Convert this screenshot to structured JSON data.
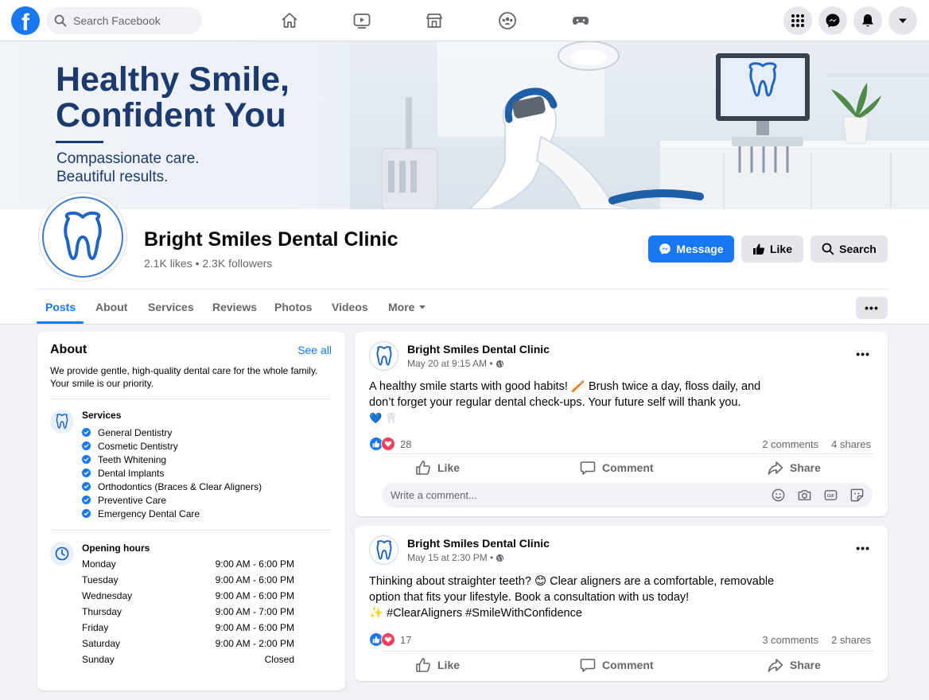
{
  "topnav": {
    "logo_letter": "f",
    "search_placeholder": "Search Facebook",
    "nav_icons": [
      "home-icon",
      "watch-icon",
      "marketplace-icon",
      "groups-icon",
      "gaming-icon"
    ],
    "right_icons": [
      "menu-grid-icon",
      "messenger-icon",
      "notifications-icon",
      "account-dropdown-icon"
    ]
  },
  "cover": {
    "headline_line1": "Healthy Smile,",
    "headline_line2": "Confident You",
    "sub_line1": "Compassionate care.",
    "sub_line2": "Beautiful results."
  },
  "page": {
    "name": "Bright Smiles Dental Clinic",
    "stats": "2.1K likes • 2.3K followers",
    "buttons": {
      "message": "Message",
      "like": "Like",
      "search": "Search"
    },
    "tabs": [
      "Posts",
      "About",
      "Services",
      "Reviews",
      "Photos",
      "Videos",
      "More"
    ],
    "active_tab": "Posts",
    "more_dots": "•••"
  },
  "about": {
    "title": "About",
    "see_all": "See all",
    "description": "We provide gentle, high-quality dental care for the whole family. Your smile is our priority.",
    "services_title": "Services",
    "services": [
      "General Dentistry",
      "Cosmetic Dentistry",
      "Teeth Whitening",
      "Dental Implants",
      "Orthodontics (Braces & Clear Aligners)",
      "Preventive Care",
      "Emergency Dental Care"
    ],
    "hours_title": "Opening hours",
    "hours": [
      {
        "day": "Monday",
        "time": "9:00 AM - 6:00 PM"
      },
      {
        "day": "Tuesday",
        "time": "9:00 AM - 6:00 PM"
      },
      {
        "day": "Wednesday",
        "time": "9:00 AM - 6:00 PM"
      },
      {
        "day": "Thursday",
        "time": "9:00 AM - 7:00 PM"
      },
      {
        "day": "Friday",
        "time": "9:00 AM - 6:00 PM"
      },
      {
        "day": "Saturday",
        "time": "9:00 AM - 2:00 PM"
      },
      {
        "day": "Sunday",
        "time": "Closed"
      }
    ]
  },
  "posts": [
    {
      "author": "Bright Smiles Dental Clinic",
      "timestamp": "May 20 at 9:15 AM",
      "text_line1": "A healthy smile starts with good habits! 🪥 Brush twice a day, floss daily, and",
      "text_line2": "don’t forget your regular dental check-ups. Your future self will thank you.",
      "text_line3": "💙 🦷",
      "reactions": "28",
      "comments": "2 comments",
      "shares": "4 shares"
    },
    {
      "author": "Bright Smiles Dental Clinic",
      "timestamp": "May 15 at 2:30 PM",
      "text_line1": "Thinking about straighter teeth? 😊 Clear aligners are a comfortable, removable",
      "text_line2": "option that fits your lifestyle. Book a consultation with us today!",
      "text_line3": "✨ #ClearAligners #SmileWithConfidence",
      "reactions": "17",
      "comments": "3 comments",
      "shares": "2 shares"
    }
  ],
  "actions": {
    "like": "Like",
    "comment": "Comment",
    "share": "Share"
  },
  "comment_placeholder": "Write a comment...",
  "post_dots": "•••",
  "colors": {
    "brand": "#1877f2",
    "cover_text": "#1d3a6e",
    "heart": "#f33e58"
  }
}
